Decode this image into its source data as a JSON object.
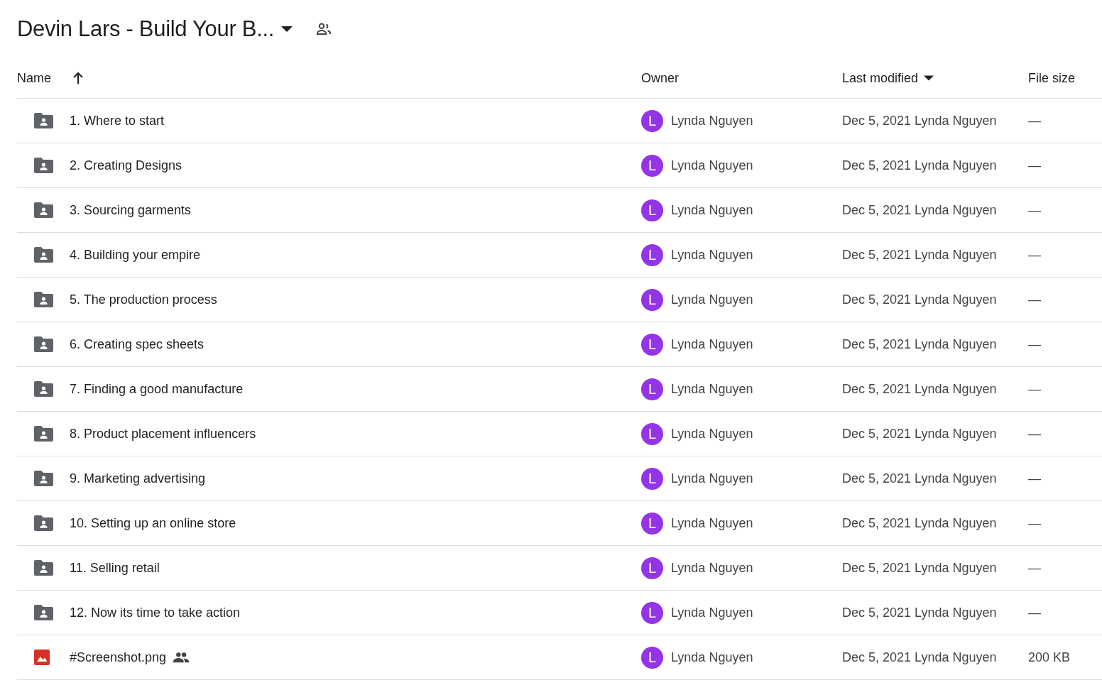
{
  "folder_title": {
    "text": "Devin Lars - Build Your B...",
    "shared": true
  },
  "table": {
    "columns": [
      {
        "label": "Name",
        "sorted": true,
        "menu": false
      },
      {
        "label": "Owner",
        "sorted": false,
        "menu": false
      },
      {
        "label": "Last modified",
        "sorted": false,
        "menu": true
      },
      {
        "label": "File size",
        "sorted": false,
        "menu": false
      }
    ],
    "rows": [
      {
        "kind": "folder",
        "name": "1. Where to start",
        "shared": false,
        "owner_initial": "L",
        "owner": "Lynda Nguyen",
        "modified": "Dec 5, 2021 Lynda Nguyen",
        "size": "—"
      },
      {
        "kind": "folder",
        "name": "2. Creating Designs",
        "shared": false,
        "owner_initial": "L",
        "owner": "Lynda Nguyen",
        "modified": "Dec 5, 2021 Lynda Nguyen",
        "size": "—"
      },
      {
        "kind": "folder",
        "name": "3. Sourcing garments",
        "shared": false,
        "owner_initial": "L",
        "owner": "Lynda Nguyen",
        "modified": "Dec 5, 2021 Lynda Nguyen",
        "size": "—"
      },
      {
        "kind": "folder",
        "name": "4. Building your empire",
        "shared": false,
        "owner_initial": "L",
        "owner": "Lynda Nguyen",
        "modified": "Dec 5, 2021 Lynda Nguyen",
        "size": "—"
      },
      {
        "kind": "folder",
        "name": "5. The production process",
        "shared": false,
        "owner_initial": "L",
        "owner": "Lynda Nguyen",
        "modified": "Dec 5, 2021 Lynda Nguyen",
        "size": "—"
      },
      {
        "kind": "folder",
        "name": "6. Creating spec sheets",
        "shared": false,
        "owner_initial": "L",
        "owner": "Lynda Nguyen",
        "modified": "Dec 5, 2021 Lynda Nguyen",
        "size": "—"
      },
      {
        "kind": "folder",
        "name": "7. Finding a good manufacture",
        "shared": false,
        "owner_initial": "L",
        "owner": "Lynda Nguyen",
        "modified": "Dec 5, 2021 Lynda Nguyen",
        "size": "—"
      },
      {
        "kind": "folder",
        "name": "8. Product placement influencers",
        "shared": false,
        "owner_initial": "L",
        "owner": "Lynda Nguyen",
        "modified": "Dec 5, 2021 Lynda Nguyen",
        "size": "—"
      },
      {
        "kind": "folder",
        "name": "9. Marketing advertising",
        "shared": false,
        "owner_initial": "L",
        "owner": "Lynda Nguyen",
        "modified": "Dec 5, 2021 Lynda Nguyen",
        "size": "—"
      },
      {
        "kind": "folder",
        "name": "10. Setting up an online store",
        "shared": false,
        "owner_initial": "L",
        "owner": "Lynda Nguyen",
        "modified": "Dec 5, 2021 Lynda Nguyen",
        "size": "—"
      },
      {
        "kind": "folder",
        "name": "11. Selling retail",
        "shared": false,
        "owner_initial": "L",
        "owner": "Lynda Nguyen",
        "modified": "Dec 5, 2021 Lynda Nguyen",
        "size": "—"
      },
      {
        "kind": "folder",
        "name": "12. Now its time to take action",
        "shared": false,
        "owner_initial": "L",
        "owner": "Lynda Nguyen",
        "modified": "Dec 5, 2021 Lynda Nguyen",
        "size": "—"
      },
      {
        "kind": "image",
        "name": "#Screenshot.png",
        "shared": true,
        "owner_initial": "L",
        "owner": "Lynda Nguyen",
        "modified": "Dec 5, 2021 Lynda Nguyen",
        "size": "200 KB"
      }
    ]
  }
}
